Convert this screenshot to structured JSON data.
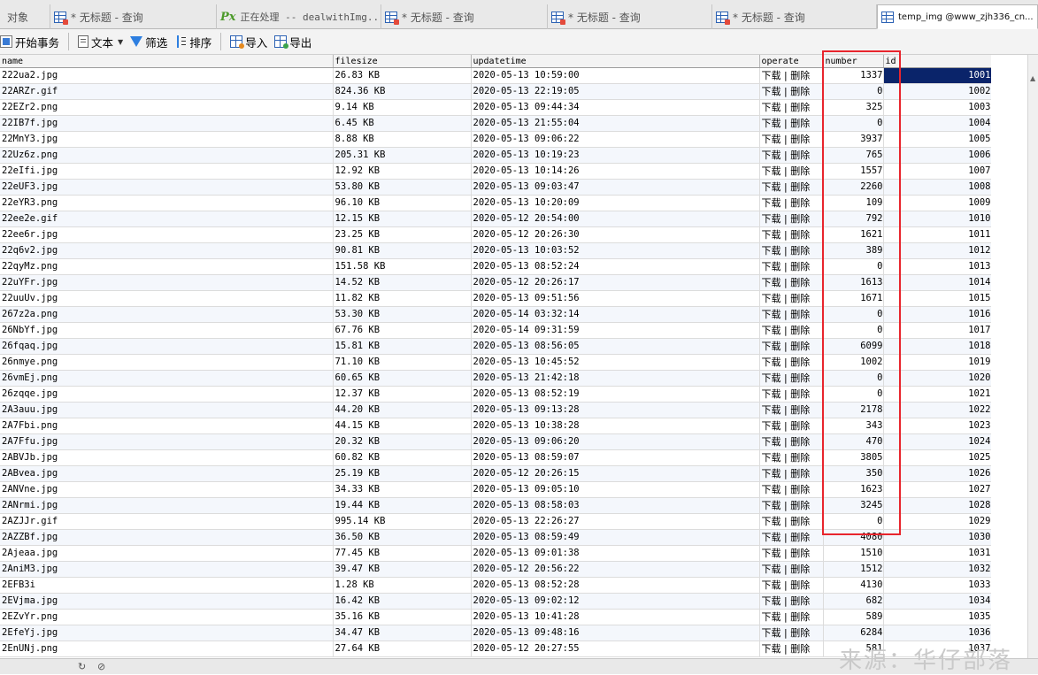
{
  "tabs": [
    {
      "label": "对象",
      "icon": "none"
    },
    {
      "label": "* 无标题 - 查询",
      "icon": "query-icon"
    },
    {
      "label": "正在处理 -- dealwithImg...",
      "icon": "px-icon"
    },
    {
      "label": "* 无标题 - 查询",
      "icon": "query-icon"
    },
    {
      "label": "* 无标题 - 查询",
      "icon": "query-icon"
    },
    {
      "label": "* 无标题 - 查询",
      "icon": "query-icon"
    },
    {
      "label": "temp_img @www_zjh336_cn...",
      "icon": "table-icon"
    }
  ],
  "toolbar": {
    "begin_transaction": "开始事务",
    "text": "文本",
    "filter": "筛选",
    "sort": "排序",
    "import": "导入",
    "export": "导出"
  },
  "columns": [
    "name",
    "filesize",
    "updatetime",
    "operate",
    "number",
    "id"
  ],
  "rows": [
    {
      "name": "222ua2.jpg",
      "filesize": "26.83 KB",
      "updatetime": "2020-05-13 10:59:00",
      "operate": "下载 | 删除",
      "number": "1337",
      "id": "1001"
    },
    {
      "name": "22ARZr.gif",
      "filesize": "824.36 KB",
      "updatetime": "2020-05-13 22:19:05",
      "operate": "下载 | 删除",
      "number": "0",
      "id": "1002"
    },
    {
      "name": "22EZr2.png",
      "filesize": "9.14 KB",
      "updatetime": "2020-05-13 09:44:34",
      "operate": "下载 | 删除",
      "number": "325",
      "id": "1003"
    },
    {
      "name": "22IB7f.jpg",
      "filesize": "6.45 KB",
      "updatetime": "2020-05-13 21:55:04",
      "operate": "下载 | 删除",
      "number": "0",
      "id": "1004"
    },
    {
      "name": "22MnY3.jpg",
      "filesize": "8.88 KB",
      "updatetime": "2020-05-13 09:06:22",
      "operate": "下载 | 删除",
      "number": "3937",
      "id": "1005"
    },
    {
      "name": "22Uz6z.png",
      "filesize": "205.31 KB",
      "updatetime": "2020-05-13 10:19:23",
      "operate": "下载 | 删除",
      "number": "765",
      "id": "1006"
    },
    {
      "name": "22eIfi.jpg",
      "filesize": "12.92 KB",
      "updatetime": "2020-05-13 10:14:26",
      "operate": "下载 | 删除",
      "number": "1557",
      "id": "1007"
    },
    {
      "name": "22eUF3.jpg",
      "filesize": "53.80 KB",
      "updatetime": "2020-05-13 09:03:47",
      "operate": "下载 | 删除",
      "number": "2260",
      "id": "1008"
    },
    {
      "name": "22eYR3.png",
      "filesize": "96.10 KB",
      "updatetime": "2020-05-13 10:20:09",
      "operate": "下载 | 删除",
      "number": "109",
      "id": "1009"
    },
    {
      "name": "22ee2e.gif",
      "filesize": "12.15 KB",
      "updatetime": "2020-05-12 20:54:00",
      "operate": "下载 | 删除",
      "number": "792",
      "id": "1010"
    },
    {
      "name": "22ee6r.jpg",
      "filesize": "23.25 KB",
      "updatetime": "2020-05-12 20:26:30",
      "operate": "下载 | 删除",
      "number": "1621",
      "id": "1011"
    },
    {
      "name": "22q6v2.jpg",
      "filesize": "90.81 KB",
      "updatetime": "2020-05-13 10:03:52",
      "operate": "下载 | 删除",
      "number": "389",
      "id": "1012"
    },
    {
      "name": "22qyMz.png",
      "filesize": "151.58 KB",
      "updatetime": "2020-05-13 08:52:24",
      "operate": "下载 | 删除",
      "number": "0",
      "id": "1013"
    },
    {
      "name": "22uYFr.jpg",
      "filesize": "14.52 KB",
      "updatetime": "2020-05-12 20:26:17",
      "operate": "下载 | 删除",
      "number": "1613",
      "id": "1014"
    },
    {
      "name": "22uuUv.jpg",
      "filesize": "11.82 KB",
      "updatetime": "2020-05-13 09:51:56",
      "operate": "下载 | 删除",
      "number": "1671",
      "id": "1015"
    },
    {
      "name": "267z2a.png",
      "filesize": "53.30 KB",
      "updatetime": "2020-05-14 03:32:14",
      "operate": "下载 | 删除",
      "number": "0",
      "id": "1016"
    },
    {
      "name": "26NbYf.jpg",
      "filesize": "67.76 KB",
      "updatetime": "2020-05-14 09:31:59",
      "operate": "下载 | 删除",
      "number": "0",
      "id": "1017"
    },
    {
      "name": "26fqaq.jpg",
      "filesize": "15.81 KB",
      "updatetime": "2020-05-13 08:56:05",
      "operate": "下载 | 删除",
      "number": "6099",
      "id": "1018"
    },
    {
      "name": "26nmye.png",
      "filesize": "71.10 KB",
      "updatetime": "2020-05-13 10:45:52",
      "operate": "下载 | 删除",
      "number": "1002",
      "id": "1019"
    },
    {
      "name": "26vmEj.png",
      "filesize": "60.65 KB",
      "updatetime": "2020-05-13 21:42:18",
      "operate": "下载 | 删除",
      "number": "0",
      "id": "1020"
    },
    {
      "name": "26zqqe.jpg",
      "filesize": "12.37 KB",
      "updatetime": "2020-05-13 08:52:19",
      "operate": "下载 | 删除",
      "number": "0",
      "id": "1021"
    },
    {
      "name": "2A3auu.jpg",
      "filesize": "44.20 KB",
      "updatetime": "2020-05-13 09:13:28",
      "operate": "下载 | 删除",
      "number": "2178",
      "id": "1022"
    },
    {
      "name": "2A7Fbi.png",
      "filesize": "44.15 KB",
      "updatetime": "2020-05-13 10:38:28",
      "operate": "下载 | 删除",
      "number": "343",
      "id": "1023"
    },
    {
      "name": "2A7Ffu.jpg",
      "filesize": "20.32 KB",
      "updatetime": "2020-05-13 09:06:20",
      "operate": "下载 | 删除",
      "number": "470",
      "id": "1024"
    },
    {
      "name": "2ABVJb.jpg",
      "filesize": "60.82 KB",
      "updatetime": "2020-05-13 08:59:07",
      "operate": "下载 | 删除",
      "number": "3805",
      "id": "1025"
    },
    {
      "name": "2ABvea.jpg",
      "filesize": "25.19 KB",
      "updatetime": "2020-05-12 20:26:15",
      "operate": "下载 | 删除",
      "number": "350",
      "id": "1026"
    },
    {
      "name": "2ANVne.jpg",
      "filesize": "34.33 KB",
      "updatetime": "2020-05-13 09:05:10",
      "operate": "下载 | 删除",
      "number": "1623",
      "id": "1027"
    },
    {
      "name": "2ANrmi.jpg",
      "filesize": "19.44 KB",
      "updatetime": "2020-05-13 08:58:03",
      "operate": "下载 | 删除",
      "number": "3245",
      "id": "1028"
    },
    {
      "name": "2AZJJr.gif",
      "filesize": "995.14 KB",
      "updatetime": "2020-05-13 22:26:27",
      "operate": "下载 | 删除",
      "number": "0",
      "id": "1029"
    },
    {
      "name": "2AZZBf.jpg",
      "filesize": "36.50 KB",
      "updatetime": "2020-05-13 08:59:49",
      "operate": "下载 | 删除",
      "number": "4080",
      "id": "1030"
    },
    {
      "name": "2Ajeaa.jpg",
      "filesize": "77.45 KB",
      "updatetime": "2020-05-13 09:01:38",
      "operate": "下载 | 删除",
      "number": "1510",
      "id": "1031"
    },
    {
      "name": "2AniM3.jpg",
      "filesize": "39.47 KB",
      "updatetime": "2020-05-12 20:56:22",
      "operate": "下载 | 删除",
      "number": "1512",
      "id": "1032"
    },
    {
      "name": "2EFB3i",
      "filesize": "1.28 KB",
      "updatetime": "2020-05-13 08:52:28",
      "operate": "下载 | 删除",
      "number": "4130",
      "id": "1033"
    },
    {
      "name": "2EVjma.jpg",
      "filesize": "16.42 KB",
      "updatetime": "2020-05-13 09:02:12",
      "operate": "下载 | 删除",
      "number": "682",
      "id": "1034"
    },
    {
      "name": "2EZvYr.png",
      "filesize": "35.16 KB",
      "updatetime": "2020-05-13 10:41:28",
      "operate": "下载 | 删除",
      "number": "589",
      "id": "1035"
    },
    {
      "name": "2EfeYj.jpg",
      "filesize": "34.47 KB",
      "updatetime": "2020-05-13 09:48:16",
      "operate": "下载 | 删除",
      "number": "6284",
      "id": "1036"
    },
    {
      "name": "2EnUNj.png",
      "filesize": "27.64 KB",
      "updatetime": "2020-05-12 20:27:55",
      "operate": "下载 | 删除",
      "number": "581",
      "id": "1037"
    }
  ],
  "selected_row": 0,
  "selected_column": "id",
  "watermark": "来源：华仔部落",
  "colors": {
    "selection": "#0a246a",
    "highlight_box": "#e8252d"
  }
}
